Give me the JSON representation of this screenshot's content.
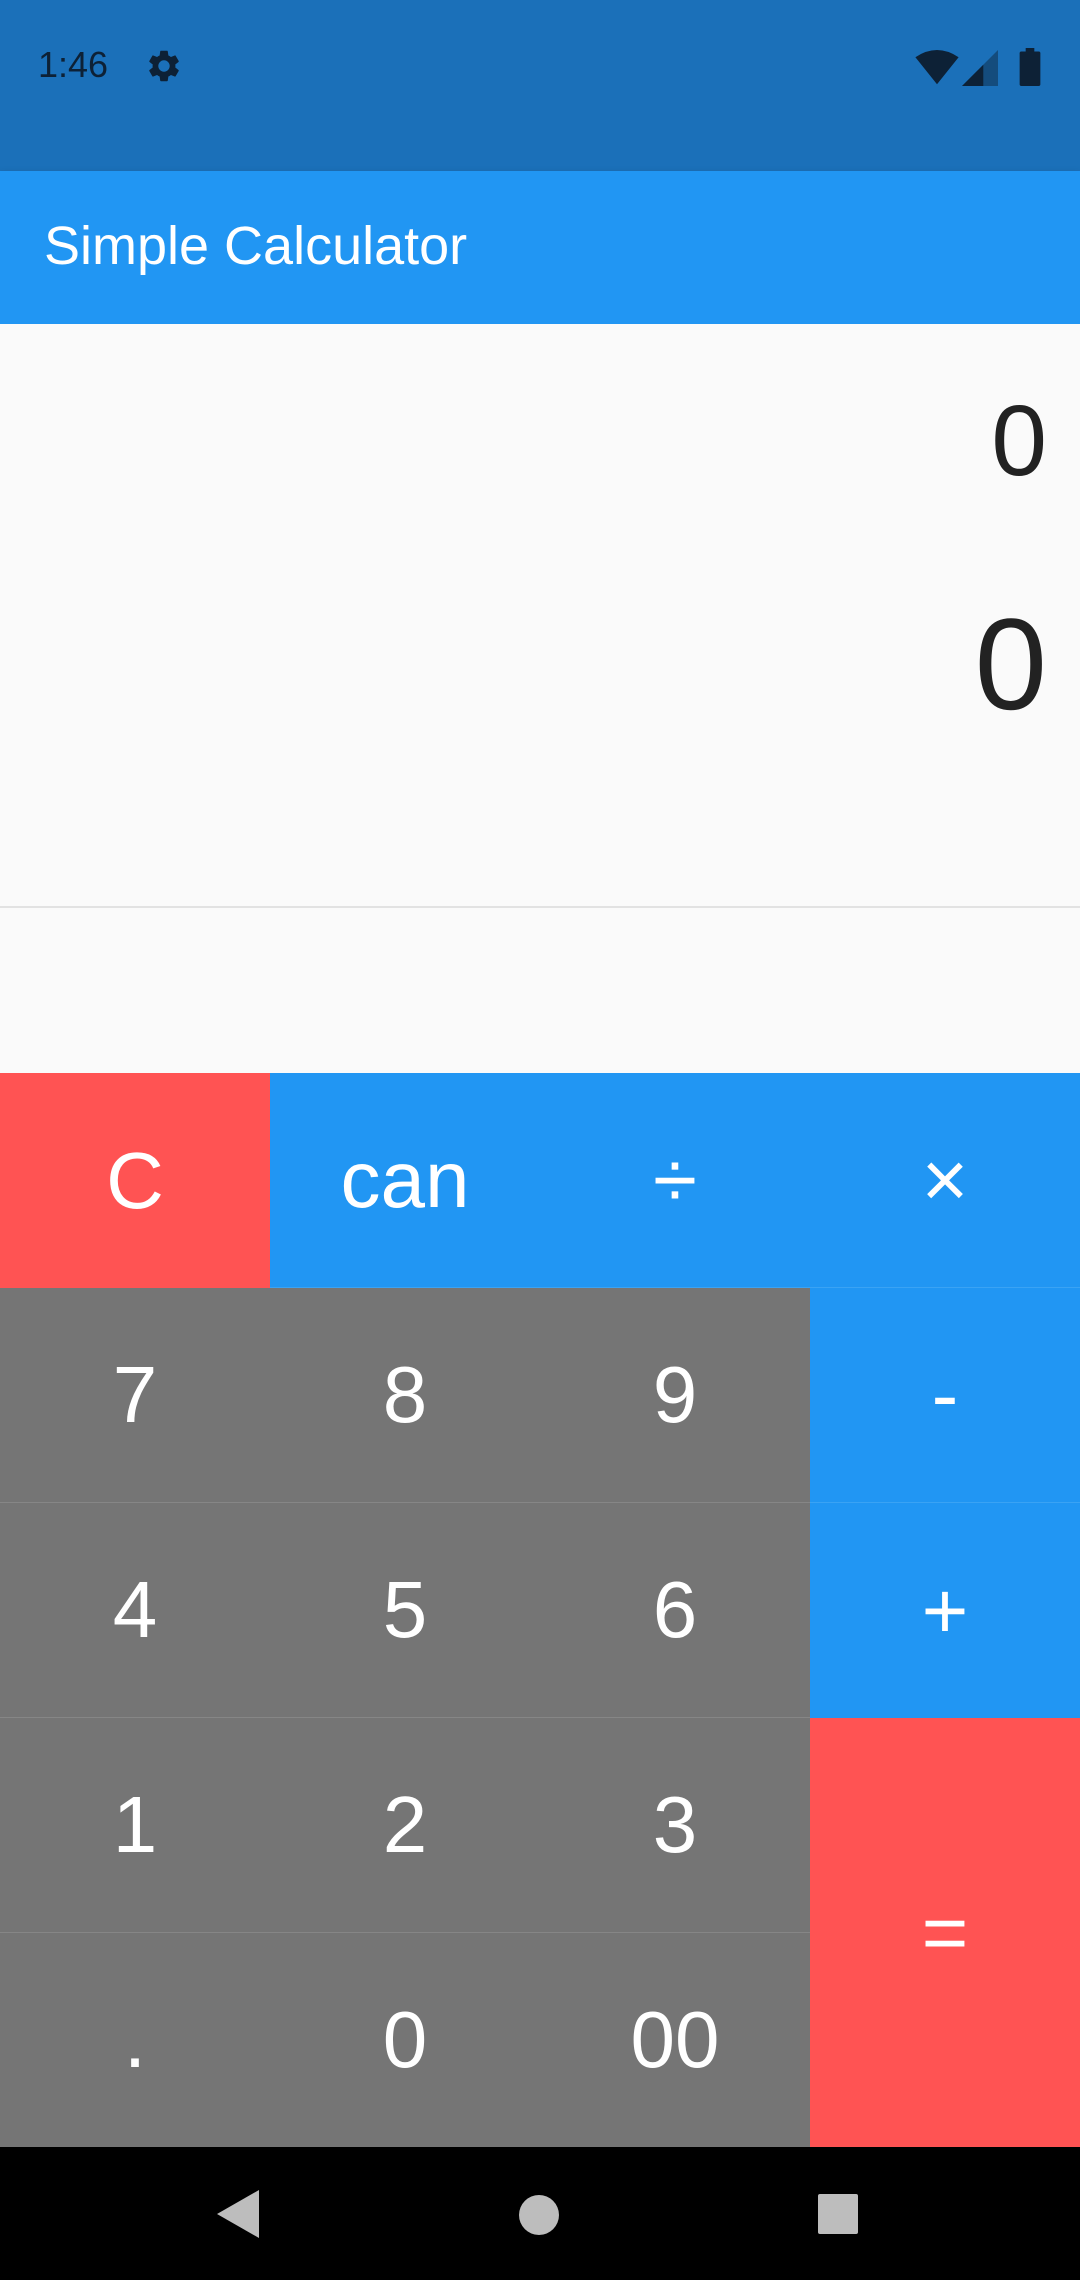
{
  "status_bar": {
    "time": "1:46",
    "icons": [
      "gear-icon",
      "wifi-icon",
      "signal-icon",
      "battery-icon"
    ]
  },
  "app_bar": {
    "title": "Simple Calculator",
    "color": "#2196f3"
  },
  "display": {
    "expression": "0",
    "result": "0"
  },
  "keypad": {
    "clear": "C",
    "cancel": "can",
    "divide": "÷",
    "multiply": "×",
    "seven": "7",
    "eight": "8",
    "nine": "9",
    "minus": "-",
    "four": "4",
    "five": "5",
    "six": "6",
    "plus": "+",
    "one": "1",
    "two": "2",
    "three": "3",
    "equals": "=",
    "dot": ".",
    "zero": "0",
    "double_zero": "00"
  },
  "colors": {
    "operator": "#2196f3",
    "number": "#757575",
    "accent": "#ff5353",
    "status_bar": "#1b70b9"
  },
  "navigation": {
    "icons": [
      "back-icon",
      "home-icon",
      "recents-icon"
    ]
  }
}
